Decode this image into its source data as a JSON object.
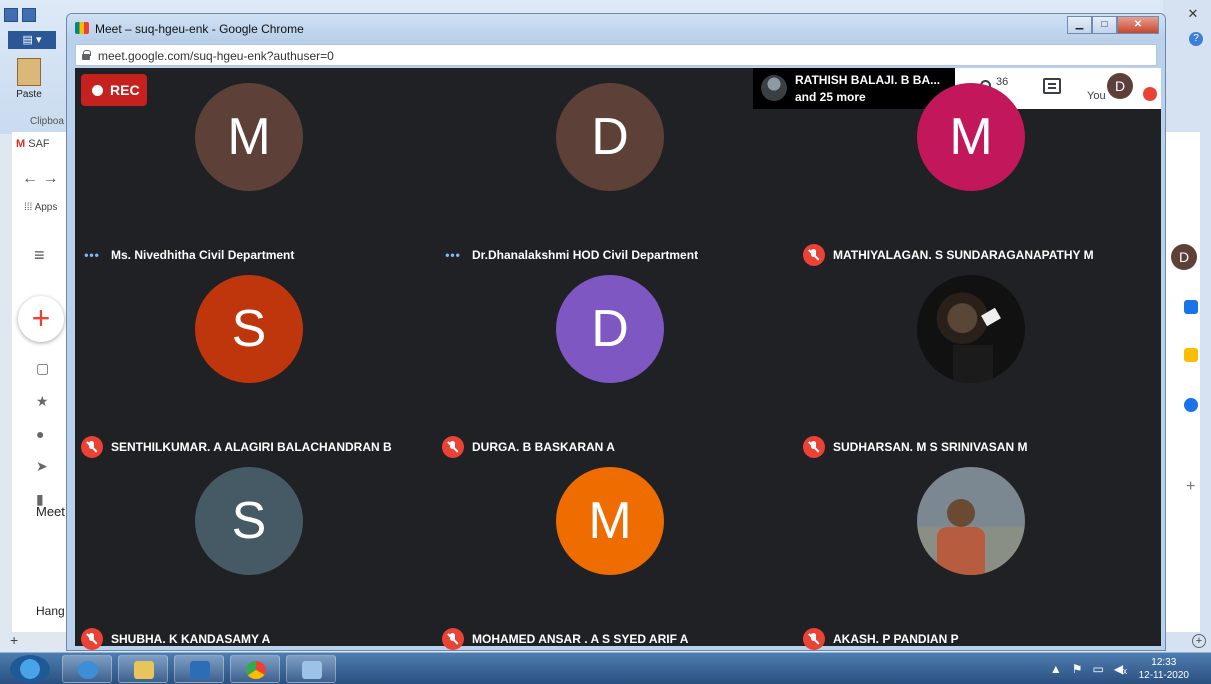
{
  "background": {
    "word": {
      "paste_label": "Paste",
      "clipboard_label": "Clipboa"
    },
    "gmail": {
      "tab_label": "SAF",
      "apps_label": "Apps",
      "meet_label": "Meet",
      "hangouts_label": "Hang",
      "avatar_initial": "D"
    }
  },
  "window": {
    "title": "Meet – suq-hgeu-enk - Google Chrome",
    "url": "meet.google.com/suq-hgeu-enk?authuser=0",
    "minimize_label": "▁",
    "maximize_label": "□",
    "close_label": "✕"
  },
  "meet": {
    "rec_label": "REC",
    "presenter": {
      "name": "RATHISH BALAJI. B BA...",
      "more": "and 25 more"
    },
    "people_count": "36",
    "you_label": "You",
    "you_initial": "D",
    "participants": [
      {
        "initial": "M",
        "color": "#5d4037",
        "name": "Ms. Nivedhitha Civil Department",
        "status": "speaking"
      },
      {
        "initial": "D",
        "color": "#5d4037",
        "name": "Dr.Dhanalakshmi HOD Civil Department",
        "status": "speaking"
      },
      {
        "initial": "M",
        "color": "#c2185b",
        "name": "MATHIYALAGAN. S SUNDARAGANAPATHY M",
        "status": "muted"
      },
      {
        "initial": "S",
        "color": "#bf360c",
        "name": "SENTHILKUMAR. A ALAGIRI BALACHANDRAN B",
        "status": "muted"
      },
      {
        "initial": "D",
        "color": "#7e57c2",
        "name": "DURGA. B BASKARAN A",
        "status": "muted"
      },
      {
        "initial": "",
        "color": "#111111",
        "name": "SUDHARSAN. M S SRINIVASAN M",
        "status": "muted",
        "photo": "dark"
      },
      {
        "initial": "S",
        "color": "#455a64",
        "name": "SHUBHA. K KANDASAMY A",
        "status": "muted"
      },
      {
        "initial": "M",
        "color": "#ef6c00",
        "name": "MOHAMED ANSAR . A S SYED ARIF A",
        "status": "muted"
      },
      {
        "initial": "",
        "color": "#7b8892",
        "name": "AKASH. P PANDIAN P",
        "status": "muted",
        "photo": "outdoor"
      }
    ]
  },
  "taskbar": {
    "time": "12:33",
    "date": "12-11-2020"
  }
}
